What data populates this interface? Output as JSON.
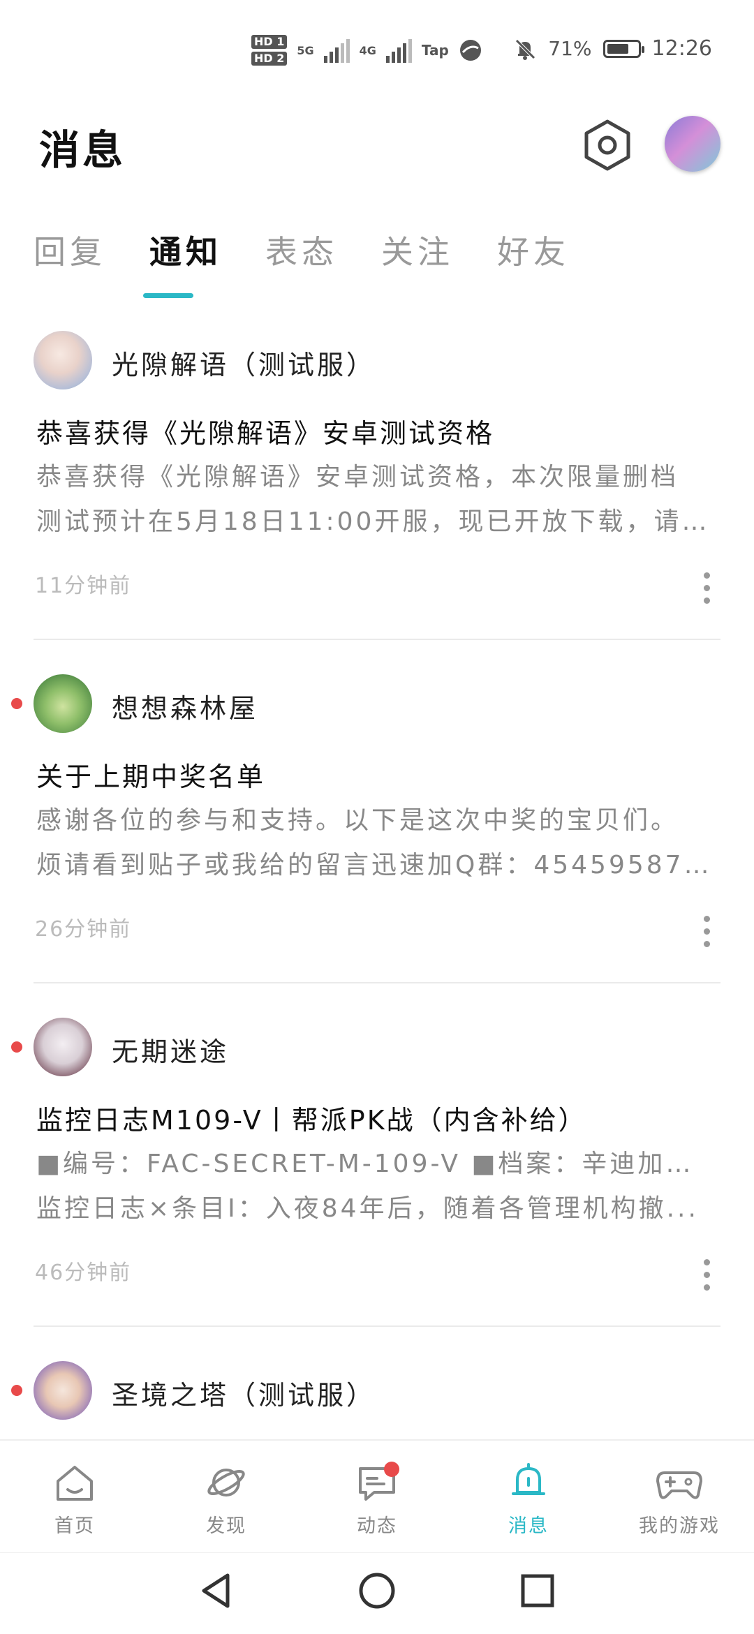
{
  "status_bar": {
    "hd1": "HD 1",
    "hd2": "HD 2",
    "net1": "5G",
    "net2": "4G",
    "tap": "Tap",
    "battery_text": "71%",
    "battery_level": 0.71,
    "time": "12:26"
  },
  "header": {
    "title": "消息"
  },
  "tabs": [
    {
      "label": "回复",
      "active": false
    },
    {
      "label": "通知",
      "active": true
    },
    {
      "label": "表态",
      "active": false
    },
    {
      "label": "关注",
      "active": false
    },
    {
      "label": "好友",
      "active": false
    }
  ],
  "items": [
    {
      "name": "光隙解语（测试服）",
      "title": "恭喜获得《光隙解语》安卓测试资格",
      "body_line1": "恭喜获得《光隙解语》安卓测试资格，本次限量删档",
      "body_line2": "测试预计在5月18日11:00开服，现已开放下载，请前...",
      "time": "11分钟前",
      "unread": false
    },
    {
      "name": "想想森林屋",
      "title": "关于上期中奖名单",
      "body_line1": "感谢各位的参与和支持。以下是这次中奖的宝贝们。",
      "body_line2": "烦请看到贴子或我给的留言迅速加Q群：454595873 ...",
      "time": "26分钟前",
      "unread": true
    },
    {
      "name": "无期迷途",
      "title": "监控日志M109-V丨帮派PK战（内含补给）",
      "body_line1": "■编号：FAC-SECRET-M-109-V ■档案：辛迪加禁闭者",
      "body_line2": "监控日志×条目Ⅰ：入夜84年后，随着各管理机构撤...",
      "time": "46分钟前",
      "unread": true
    },
    {
      "name": "圣境之塔（测试服）",
      "unread": true
    }
  ],
  "bottom_nav": [
    {
      "label": "首页",
      "icon": "home-icon",
      "active": false,
      "badge": false
    },
    {
      "label": "发现",
      "icon": "planet-icon",
      "active": false,
      "badge": false
    },
    {
      "label": "动态",
      "icon": "chat-icon",
      "active": false,
      "badge": true
    },
    {
      "label": "消息",
      "icon": "bell-icon",
      "active": true,
      "badge": false
    },
    {
      "label": "我的游戏",
      "icon": "gamepad-icon",
      "active": false,
      "badge": false
    }
  ],
  "colors": {
    "accent": "#2bb8c6",
    "unread_dot": "#e84a4a"
  }
}
